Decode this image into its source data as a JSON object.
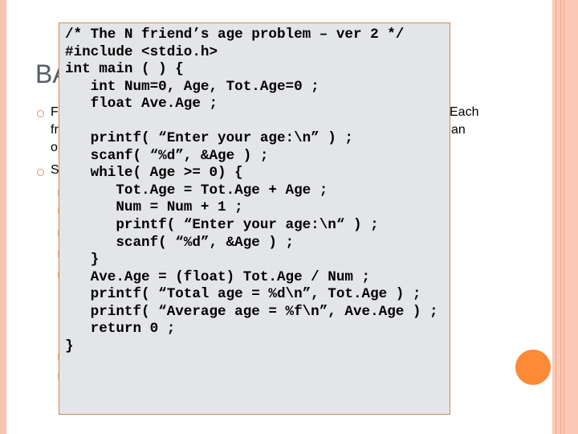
{
  "slide": {
    "title_fragment": "BA",
    "bullet_fragments": [
      "F",
      "fr",
      "o",
      "S"
    ],
    "right_fragments": [
      "Each",
      "an"
    ]
  },
  "code": {
    "lines": [
      "/* The N friend’s age problem – ver 2 */",
      "#include <stdio.h>",
      "int main ( ) {",
      "   int Num=0, Age, Tot.Age=0 ;",
      "   float Ave.Age ;",
      "",
      "   printf( “Enter your age:\\n” ) ;",
      "   scanf( “%d”, &Age ) ;",
      "   while( Age >= 0) {",
      "      Tot.Age = Tot.Age + Age ;",
      "      Num = Num + 1 ;",
      "      printf( “Enter your age:\\n“ ) ;",
      "      scanf( “%d”, &Age ) ;",
      "   }",
      "   Ave.Age = (float) Tot.Age / Num ;",
      "   printf( “Total age = %d\\n”, Tot.Age ) ;",
      "   printf( “Average age = %f\\n”, Ave.Age ) ;",
      "   return 0 ;",
      "}"
    ]
  },
  "colors": {
    "accent": "#fc8a36",
    "stripe": "#f8c4b0",
    "code_bg": "#e4e5e8"
  }
}
